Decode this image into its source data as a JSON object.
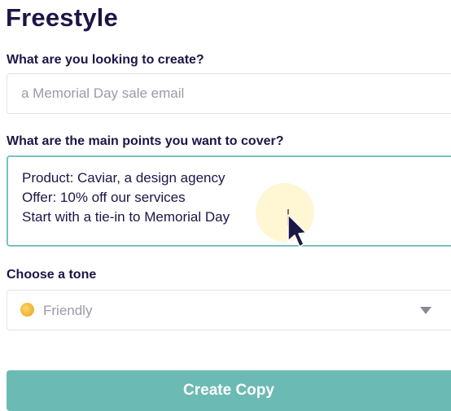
{
  "page": {
    "title": "Freestyle"
  },
  "create_field": {
    "label": "What are you looking to create?",
    "placeholder": "a Memorial Day sale email",
    "value": ""
  },
  "points_field": {
    "label": "What are the main points you want to cover?",
    "lines": [
      "Product: Caviar, a design agency",
      "Offer: 10% off our services",
      "Start with a tie-in to Memorial Day"
    ]
  },
  "tone_field": {
    "label": "Choose a tone",
    "selected": "Friendly",
    "icon": "smiley-face-icon"
  },
  "submit": {
    "label": "Create Copy"
  },
  "colors": {
    "heading": "#1b1646",
    "accent": "#6cbab4",
    "focus_border": "#77c3bc",
    "placeholder": "#9b9aa8"
  }
}
